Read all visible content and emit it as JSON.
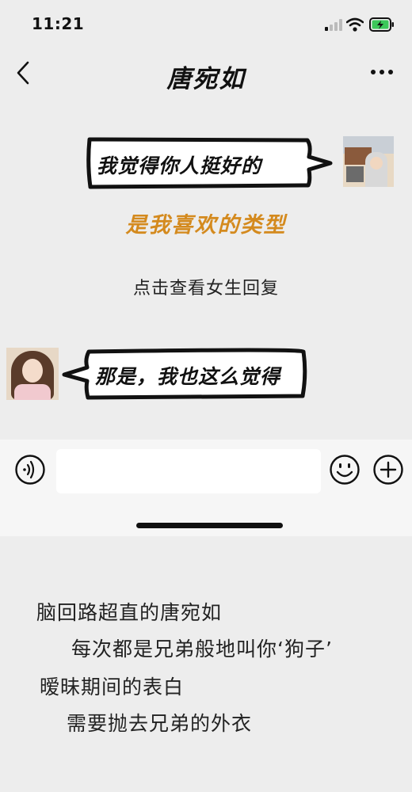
{
  "status_bar": {
    "time": "11:21"
  },
  "header": {
    "title": "唐宛如",
    "back_icon": "chevron-left-icon",
    "more_icon": "more-dots-icon"
  },
  "chat": {
    "outgoing_message": "我觉得你人挺好的",
    "caption": "是我喜欢的类型",
    "view_reply": "点击查看女生回复",
    "incoming_message": "那是，我也这么觉得",
    "caption_color": "#d48a1e"
  },
  "input_bar": {
    "voice_icon": "voice-icon",
    "emoji_icon": "emoji-icon",
    "add_icon": "plus-circle-icon",
    "input_value": ""
  },
  "lyrics": [
    "脑回路超直的唐宛如",
    "每次都是兄弟般地叫你‘狗子’",
    "暧昧期间的表白",
    "需要抛去兄弟的外衣"
  ]
}
